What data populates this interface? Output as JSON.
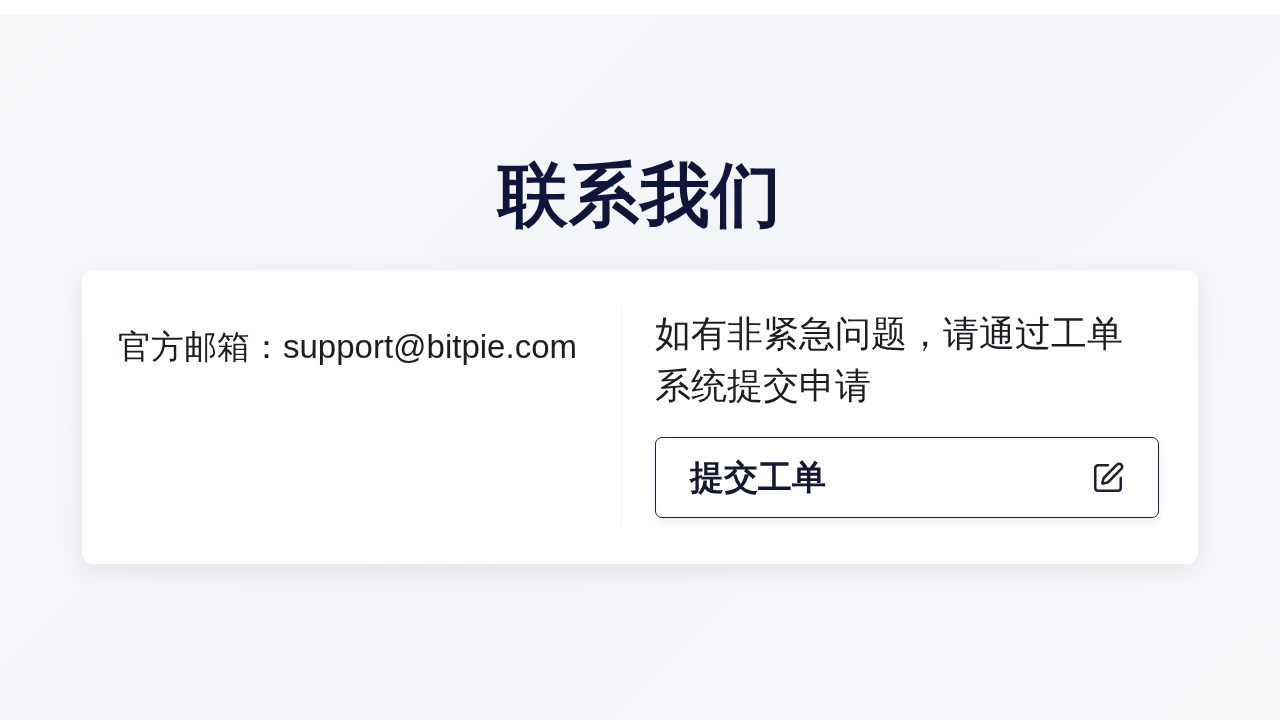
{
  "page": {
    "title": "联系我们"
  },
  "contact_card": {
    "email_text": "官方邮箱：support@bitpie.com",
    "ticket_note": "如有非紧急问题，请通过工单系统提交申请",
    "ticket_button": {
      "label": "提交工单"
    }
  }
}
